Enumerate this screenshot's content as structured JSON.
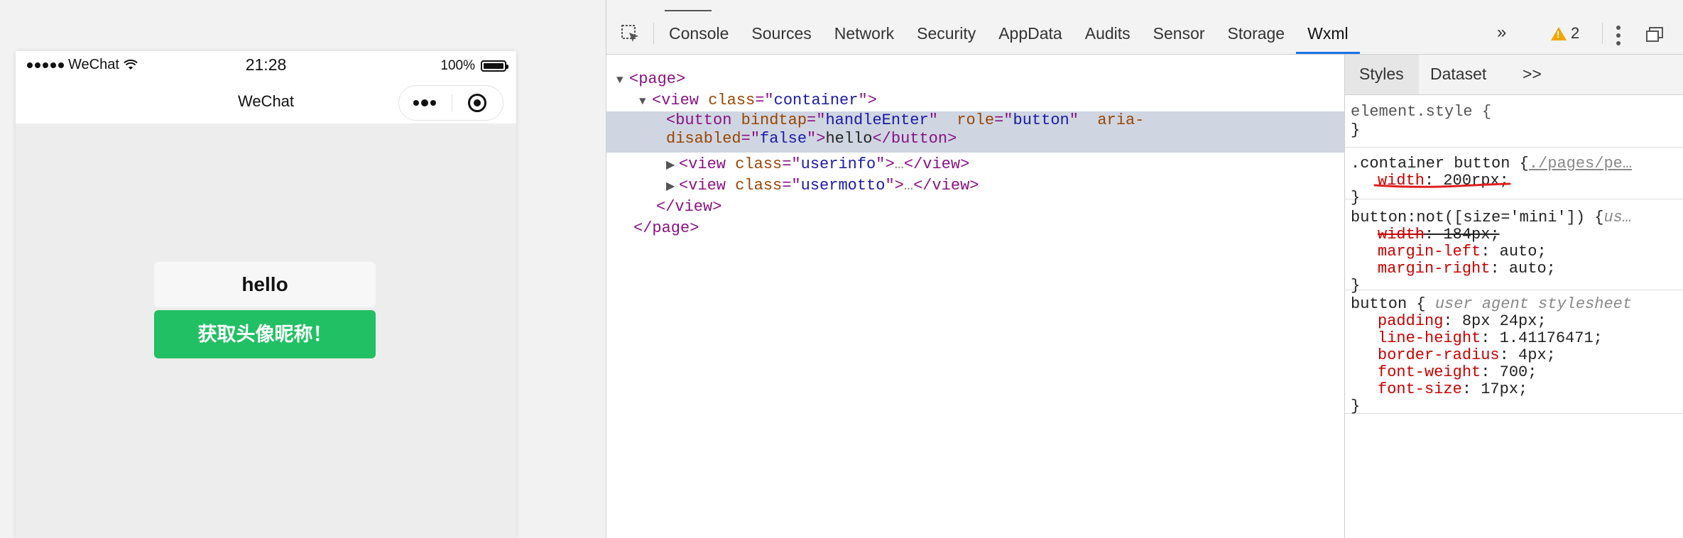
{
  "simulator": {
    "status_carrier": "WeChat",
    "status_time": "21:28",
    "status_battery": "100%",
    "nav_title": "WeChat",
    "button_hello": "hello",
    "button_green": "获取头像昵称！",
    "colors": {
      "green": "#22c064"
    }
  },
  "devtools": {
    "tabs": [
      "Console",
      "Sources",
      "Network",
      "Security",
      "AppData",
      "Audits",
      "Sensor",
      "Storage",
      "Wxml"
    ],
    "active_tab": "Wxml",
    "more_label": "»",
    "warning_count": "2",
    "tree": {
      "page_open": "<page>",
      "view_tag_open": "<view",
      "view_class_attr": "class",
      "view_class_val": "container",
      "button_tag": "<button",
      "button_attr1": "bindtap",
      "button_val1": "handleEnter",
      "button_attr2": "role",
      "button_val2": "button",
      "button_attr3_a": "aria-",
      "button_attr3_b": "disabled",
      "button_val3": "false",
      "button_text": "hello",
      "button_close": "</button>",
      "userinfo_open": "<view",
      "userinfo_attr": "class",
      "userinfo_val": "userinfo",
      "userinfo_ellip": "…",
      "userinfo_close": "</view>",
      "usermotto_open": "<view",
      "usermotto_attr": "class",
      "usermotto_val": "usermotto",
      "usermotto_ellip": "…",
      "usermotto_close": "</view>",
      "view_close": "</view>",
      "page_close": "</page>"
    },
    "styles": {
      "tabs": [
        "Styles",
        "Dataset",
        ">>"
      ],
      "rule1_selector": "element.style {",
      "rule1_close": "}",
      "rule2_selector": ".container button {",
      "rule2_origin": "./pages/pe…",
      "rule2_prop": "width",
      "rule2_val": "200rpx",
      "rule2_close": "}",
      "rule3_selector": "button:not([size='mini']) {",
      "rule3_origin": "us…",
      "rule3_props": [
        {
          "prop": "width",
          "val": "184px",
          "strike": true
        },
        {
          "prop": "margin-left",
          "val": "auto",
          "strike": false
        },
        {
          "prop": "margin-right",
          "val": "auto",
          "strike": false
        }
      ],
      "rule3_close": "}",
      "rule4_selector": "button {",
      "rule4_origin": "user agent stylesheet",
      "rule4_props": [
        {
          "prop": "padding",
          "val": "8px 24px"
        },
        {
          "prop": "line-height",
          "val": "1.41176471"
        },
        {
          "prop": "border-radius",
          "val": "4px"
        },
        {
          "prop": "font-weight",
          "val": "700"
        },
        {
          "prop": "font-size",
          "val": "17px"
        }
      ],
      "rule4_close": "}"
    }
  }
}
